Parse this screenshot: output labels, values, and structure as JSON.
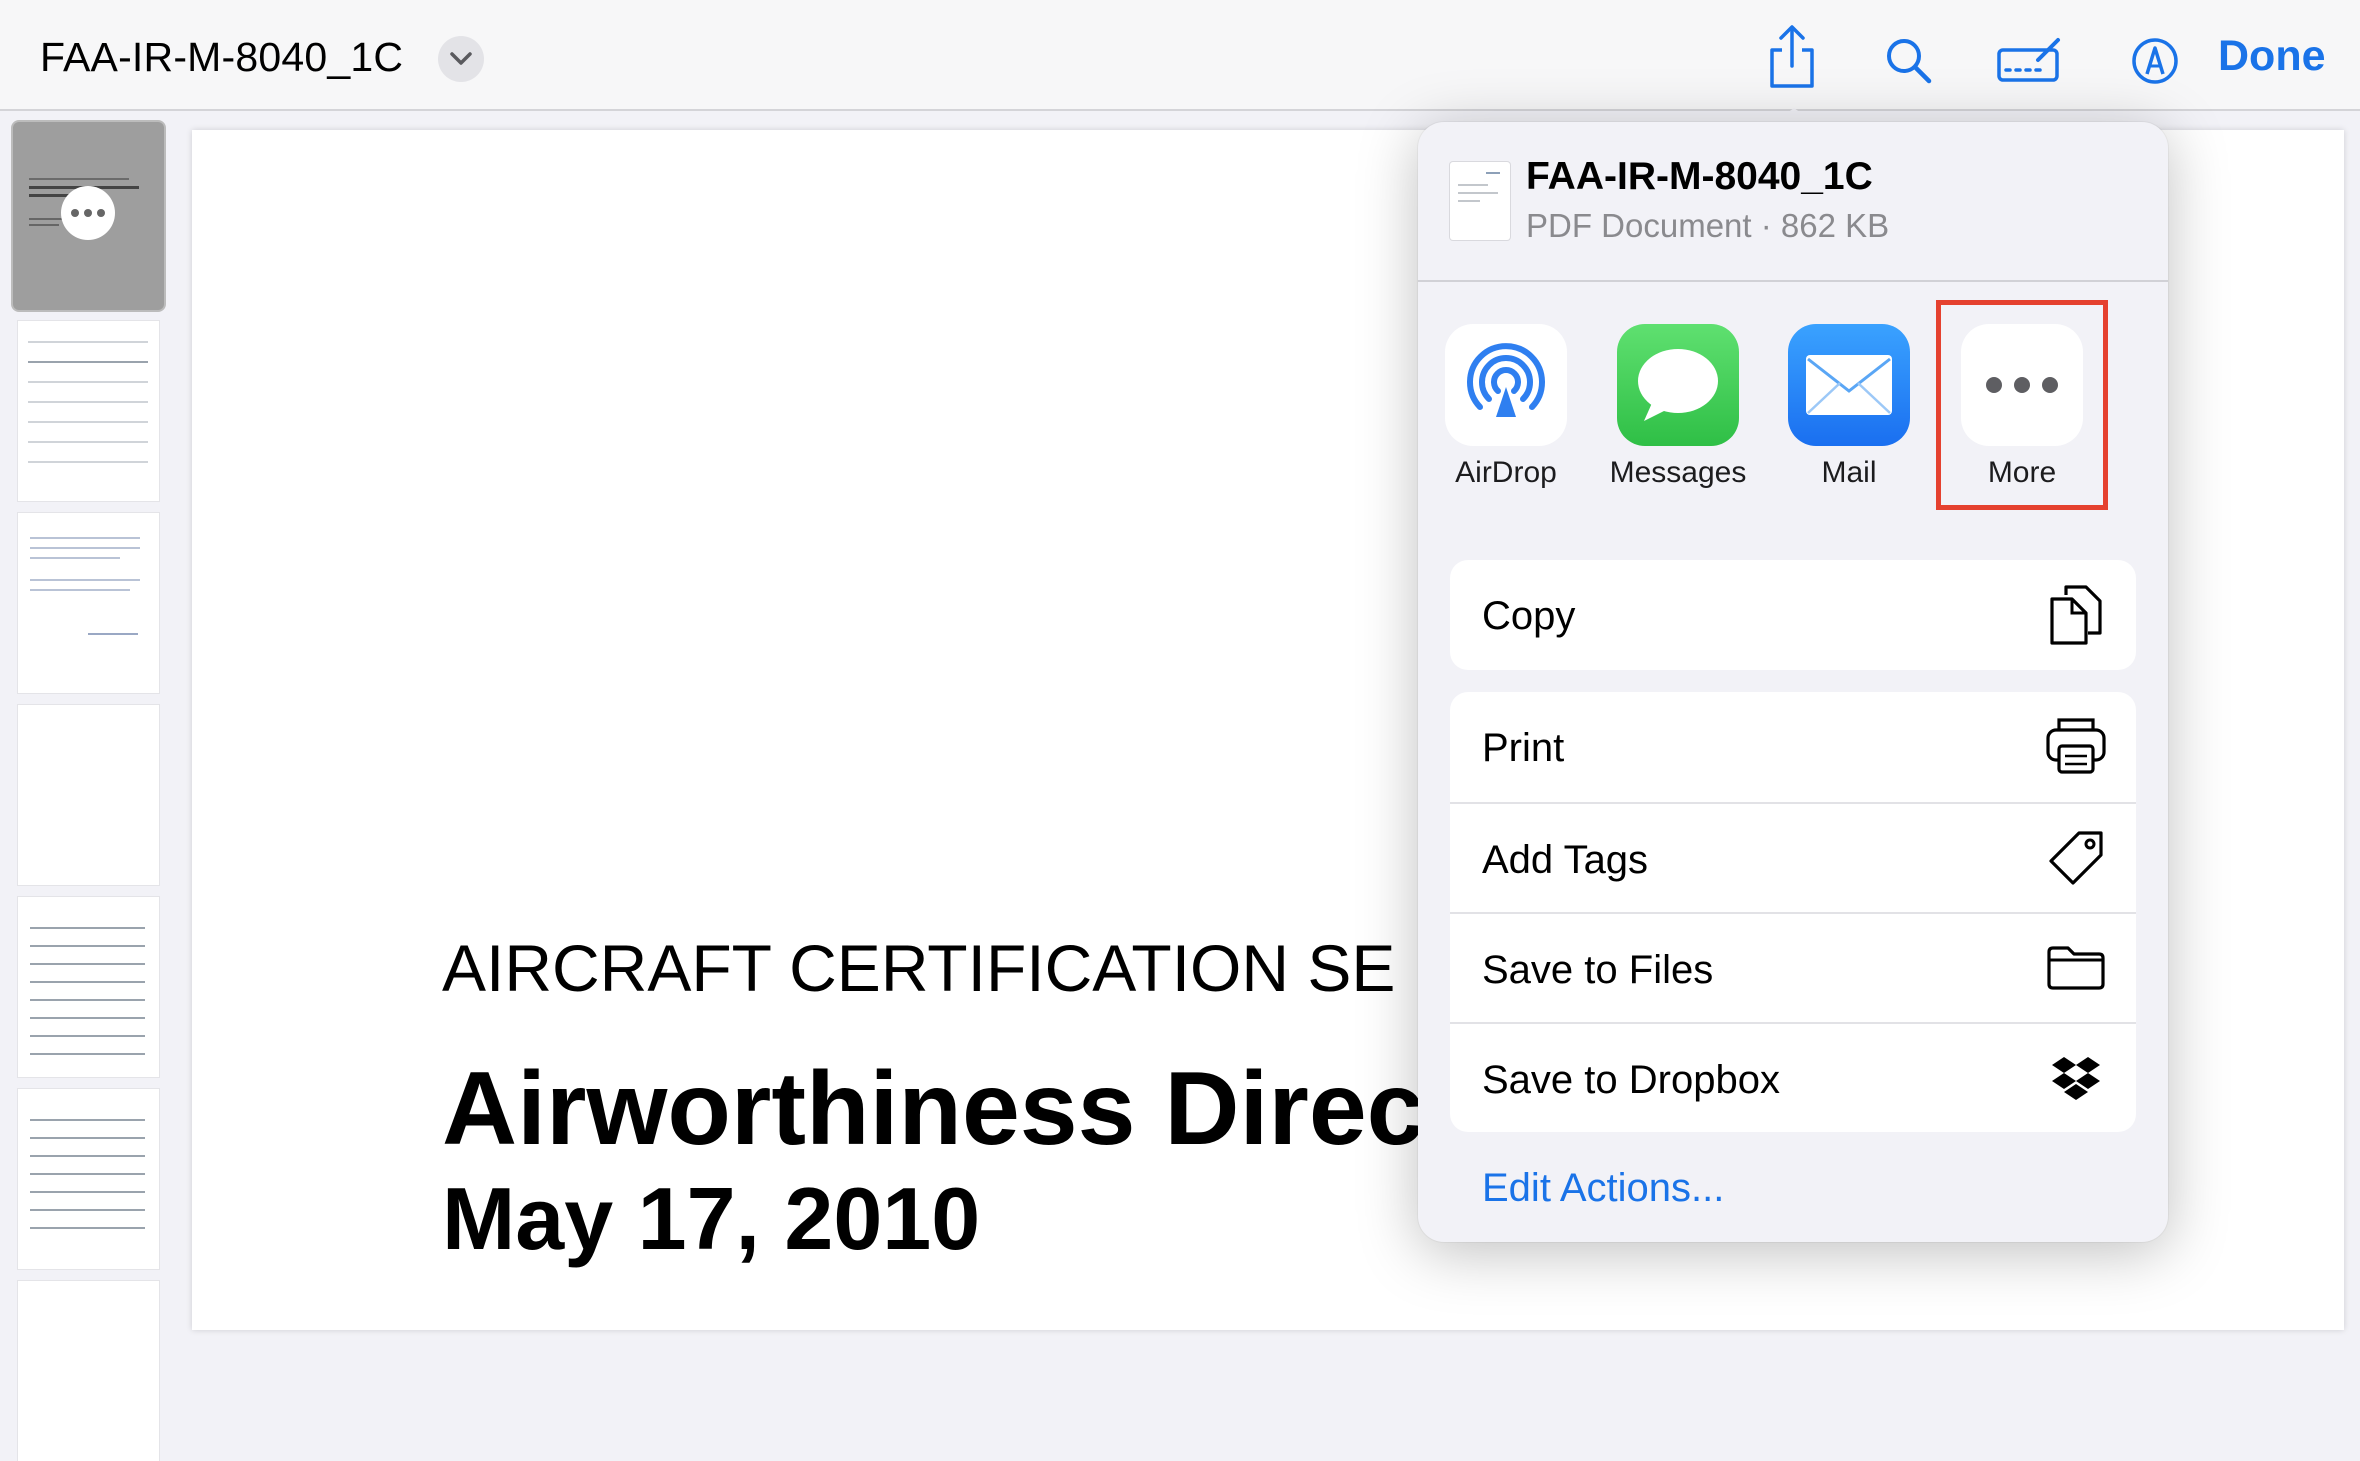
{
  "toolbar": {
    "document_title": "FAA-IR-M-8040_1C",
    "done_label": "Done",
    "icons": [
      "chevron-down-icon",
      "share-icon",
      "search-icon",
      "markup-icon",
      "pen-icon"
    ]
  },
  "page": {
    "cert_line": "AIRCRAFT CERTIFICATION SE",
    "title": "Airworthiness Direct",
    "date": "May 17, 2010"
  },
  "share_sheet": {
    "file_name": "FAA-IR-M-8040_1C",
    "file_meta": "PDF Document · 862 KB",
    "apps": [
      {
        "label": "AirDrop",
        "icon": "airdrop-icon"
      },
      {
        "label": "Messages",
        "icon": "messages-icon"
      },
      {
        "label": "Mail",
        "icon": "mail-icon"
      },
      {
        "label": "More",
        "icon": "more-icon"
      }
    ],
    "actions_group1": [
      {
        "label": "Copy",
        "icon": "copy-icon"
      }
    ],
    "actions_group2": [
      {
        "label": "Print",
        "icon": "print-icon"
      },
      {
        "label": "Add Tags",
        "icon": "tag-icon"
      },
      {
        "label": "Save to Files",
        "icon": "folder-icon"
      },
      {
        "label": "Save to Dropbox",
        "icon": "dropbox-icon"
      }
    ],
    "edit_actions_label": "Edit Actions..."
  },
  "colors": {
    "accent": "#1a73e8",
    "highlight": "#e5412f",
    "messages_green": "#34c759",
    "mail_blue": "#1e7cf2"
  }
}
